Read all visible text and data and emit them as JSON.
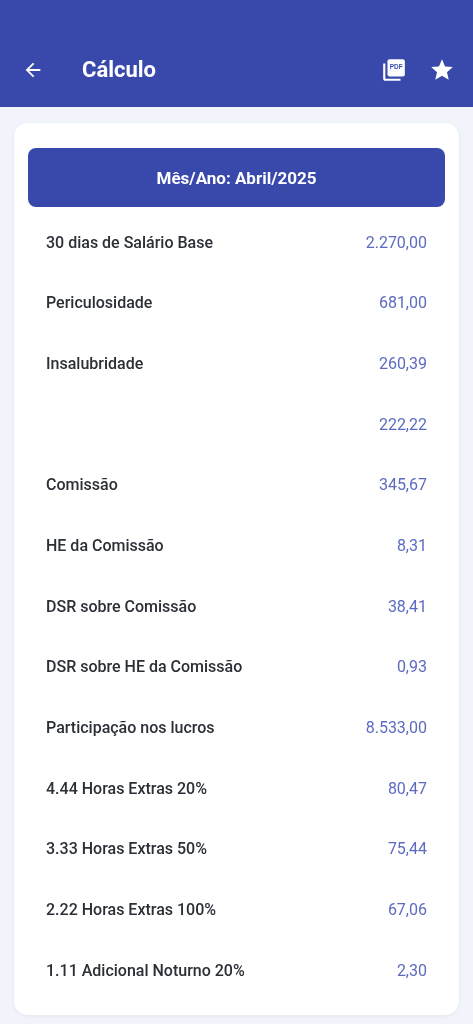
{
  "app_bar": {
    "title": "Cálculo",
    "pdf_icon_text": "PDF"
  },
  "period": "Mês/Ano: Abril/2025",
  "rows": [
    {
      "label": "30 dias de Salário Base",
      "value": "2.270,00"
    },
    {
      "label": "Periculosidade",
      "value": "681,00"
    },
    {
      "label": "Insalubridade",
      "value": "260,39"
    },
    {
      "value": "222,22"
    },
    {
      "label": "Comissão",
      "value": "345,67"
    },
    {
      "label": "HE da Comissão",
      "value": "8,31"
    },
    {
      "label": "DSR sobre Comissão",
      "value": "38,41"
    },
    {
      "label": "DSR sobre HE da Comissão",
      "value": "0,93"
    },
    {
      "label": "Participação nos lucros",
      "value": "8.533,00"
    },
    {
      "label": "4.44 Horas Extras 20%",
      "value": "80,47"
    },
    {
      "label": "3.33 Horas Extras 50%",
      "value": "75,44"
    },
    {
      "label": "2.22 Horas Extras 100%",
      "value": "67,06"
    },
    {
      "label": "1.11 Adicional Noturno 20%",
      "value": "2,30"
    }
  ]
}
